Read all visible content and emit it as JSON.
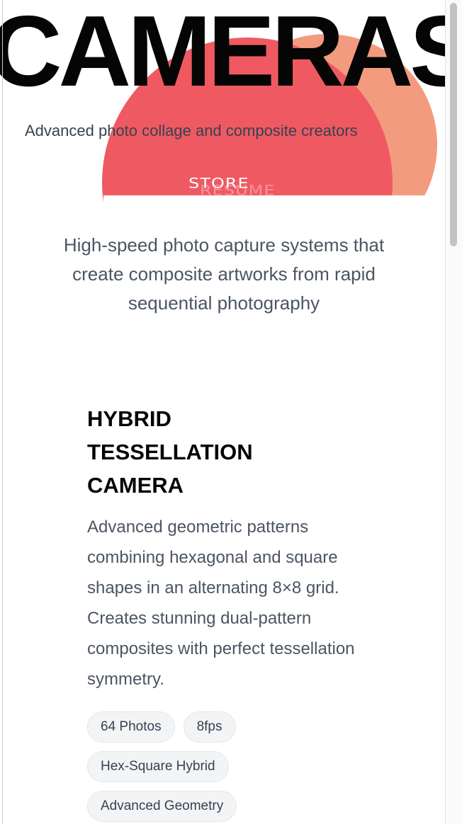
{
  "hero": {
    "title": "CAMERAS",
    "subtitle": "Advanced photo collage and composite creators",
    "store_link": "STORE",
    "ghost_link": "RESUME"
  },
  "intro": {
    "text": "High-speed photo capture systems that create composite artworks from rapid sequential photography"
  },
  "product": {
    "title": "HYBRID TESSELLATION CAMERA",
    "description": "Advanced geometric patterns combining hexagonal and square shapes in an alternating 8×8 grid. Creates stunning dual-pattern composites with perfect tessellation symmetry.",
    "tags": [
      "64 Photos",
      "8fps",
      "Hex-Square Hybrid",
      "Advanced Geometry"
    ]
  },
  "colors": {
    "circle_front": "#ef5a62",
    "circle_back": "#f39b7e",
    "text_dark": "#050505",
    "text_muted": "#4b5563",
    "tag_bg": "#f3f4f6"
  }
}
